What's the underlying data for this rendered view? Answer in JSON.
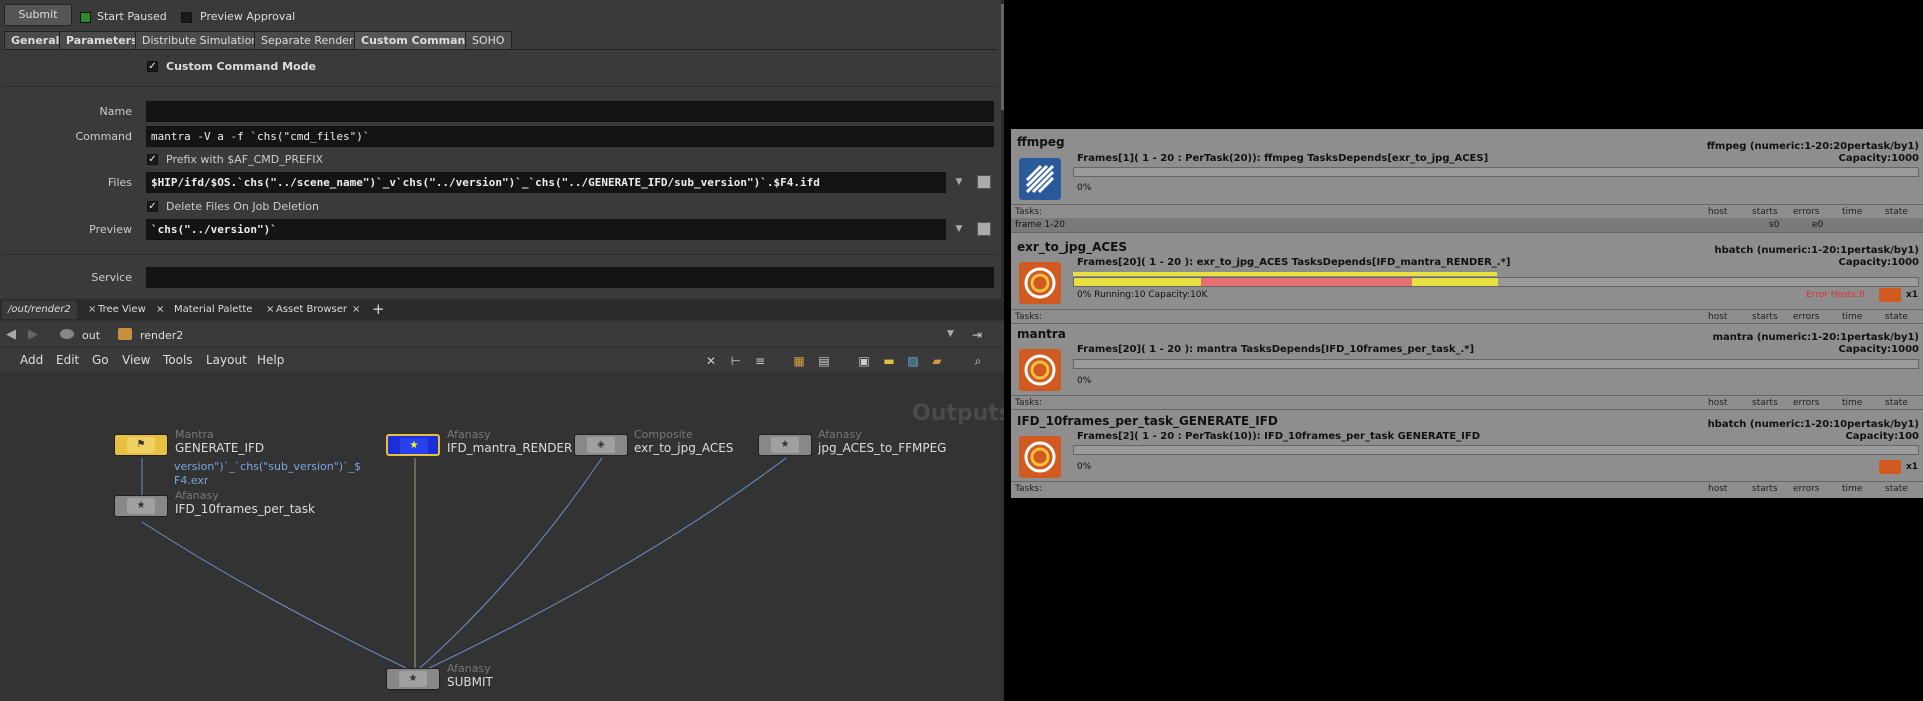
{
  "param": {
    "submit_label": "Submit",
    "start_paused": "Start Paused",
    "preview_approval": "Preview Approval",
    "tabs": [
      "General",
      "Parameters",
      "Distribute Simulation",
      "Separate Render",
      "Custom Command",
      "SOHO"
    ],
    "custom_command_mode": "Custom Command Mode",
    "name_label": "Name",
    "name_value": "",
    "command_label": "Command",
    "command_value": "mantra -V a -f `chs(\"cmd_files\")`",
    "prefix_label": "Prefix with $AF_CMD_PREFIX",
    "files_label": "Files",
    "files_value": "$HIP/ifd/$OS.`chs(\"../scene_name\")`_v`chs(\"../version\")`_`chs(\"../GENERATE_IFD/sub_version\")`.$F4.ifd",
    "delete_files_label": "Delete Files On Job Deletion",
    "preview_label": "Preview",
    "preview_value": "`chs(\"../version\")`",
    "service_label": "Service",
    "service_value": ""
  },
  "net": {
    "tabs": [
      "/out/render2",
      "Tree View",
      "Material Palette",
      "Asset Browser"
    ],
    "path_root": "out",
    "path_node": "render2",
    "menus": [
      "Add",
      "Edit",
      "Go",
      "View",
      "Tools",
      "Layout",
      "Help"
    ],
    "outputs_label": "Outputs",
    "nodes": [
      {
        "type": "Mantra",
        "name": "GENERATE_IFD"
      },
      {
        "type": "Afanasy",
        "name": "IFD_10frames_per_task"
      },
      {
        "type": "Afanasy",
        "name": "IFD_mantra_RENDER"
      },
      {
        "type": "Composite",
        "name": "exr_to_jpg_ACES"
      },
      {
        "type": "Afanasy",
        "name": "jpg_ACES_to_FFMPEG"
      },
      {
        "type": "Afanasy",
        "name": "SUBMIT"
      }
    ],
    "note_line1": "version\")`_`chs(\"sub_version\")`_$",
    "note_line2": "F4.exr"
  },
  "afanasy": {
    "tasks_label": "Tasks:",
    "cols": [
      "host",
      "starts",
      "errors",
      "time",
      "state"
    ],
    "frame_range_label": "frame 1-20",
    "frame_s": "s0",
    "frame_e": "e0",
    "jobs": [
      {
        "title": "ffmpeg",
        "service": "ffmpeg (numeric:1-20:20pertask/by1)",
        "block": "Frames[1]( 1 - 20  : PerTask(20)): ffmpeg TasksDepends[exr_to_jpg_ACES]",
        "capacity": "Capacity:1000",
        "progress": "0%",
        "progress_value": 0
      },
      {
        "title": "exr_to_jpg_ACES",
        "service": "hbatch (numeric:1-20:1pertask/by1)",
        "block": "Frames[20]( 1 - 20 ): exr_to_jpg_ACES TasksDepends[IFD_mantra_RENDER_.*]",
        "capacity": "Capacity:1000",
        "progress": "0% Running:10 Capacity:10K",
        "progress_value": 0,
        "error_hosts": "Error Hosts:8",
        "count": "x1"
      },
      {
        "title": "mantra",
        "service": "mantra (numeric:1-20:1pertask/by1)",
        "block": "Frames[20]( 1 - 20 ): mantra TasksDepends[IFD_10frames_per_task_.*]",
        "capacity": "Capacity:1000",
        "progress": "0%",
        "progress_value": 0
      },
      {
        "title": "IFD_10frames_per_task_GENERATE_IFD",
        "service": "hbatch (numeric:1-20:10pertask/by1)",
        "block": "Frames[2]( 1 - 20  : PerTask(10)): IFD_10frames_per_task GENERATE_IFD",
        "capacity": "Capacity:100",
        "progress": "0%",
        "progress_value": 0,
        "count": "x1"
      }
    ]
  }
}
